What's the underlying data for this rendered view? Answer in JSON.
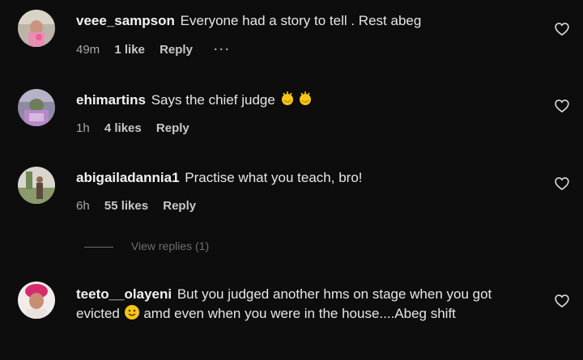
{
  "comments": [
    {
      "username": "veee_sampson",
      "text": "Everyone had a story to tell . Rest abeg",
      "time": "49m",
      "likes": "1 like",
      "reply": "Reply",
      "more": "···"
    },
    {
      "username": "ehimartins",
      "text": "Says the chief judge",
      "emoji": "clapping-hands-icon",
      "time": "1h",
      "likes": "4 likes",
      "reply": "Reply"
    },
    {
      "username": "abigailadannia1",
      "text": "Practise what you teach, bro!",
      "time": "6h",
      "likes": "55 likes",
      "reply": "Reply"
    },
    {
      "username": "teeto__olayeni",
      "text_part1": "But you judged another hms on stage when you got evicted",
      "emoji": "slightly-smiling-face-icon",
      "text_part2": " amd even when you were in the house....Abeg shift"
    }
  ],
  "view_replies": "View replies (1)",
  "colors": {
    "background": "#0d0d0d",
    "text": "#e6e6e6",
    "muted": "#a8a8a8",
    "faint": "#6e6e6e"
  }
}
